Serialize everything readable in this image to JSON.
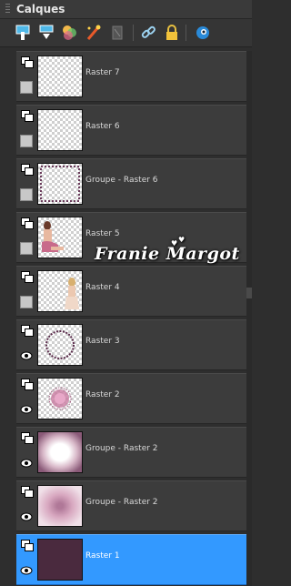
{
  "panel": {
    "title": "Calques"
  },
  "toolbar": {
    "buttons": [
      {
        "icon": "new-layer-icon"
      },
      {
        "icon": "new-mask-layer-icon"
      },
      {
        "icon": "adjustment-layer-icon"
      },
      {
        "icon": "layer-effects-icon"
      },
      {
        "icon": "delete-layer-icon"
      },
      {
        "icon": "link-icon"
      },
      {
        "icon": "lock-icon"
      },
      {
        "icon": "visibility-toggle-icon"
      }
    ]
  },
  "layers": [
    {
      "name": "Raster 7",
      "visible": false,
      "thumb": "empty",
      "selected": false
    },
    {
      "name": "Raster 6",
      "visible": false,
      "thumb": "empty",
      "selected": false
    },
    {
      "name": "Groupe - Raster 6",
      "visible": false,
      "thumb": "frame",
      "selected": false
    },
    {
      "name": "Raster 5",
      "visible": false,
      "thumb": "woman-sitting",
      "selected": false
    },
    {
      "name": "Raster 4",
      "visible": false,
      "thumb": "woman-standing",
      "selected": false
    },
    {
      "name": "Raster 3",
      "visible": true,
      "thumb": "circle-ring",
      "selected": false
    },
    {
      "name": "Raster 2",
      "visible": true,
      "thumb": "lace-flower",
      "selected": false
    },
    {
      "name": "Groupe - Raster 2",
      "visible": true,
      "thumb": "mauve-vignette",
      "selected": false
    },
    {
      "name": "Groupe - Raster 2",
      "visible": true,
      "thumb": "mauve-oval",
      "selected": false
    },
    {
      "name": "Raster 1",
      "visible": true,
      "thumb": "solid-plum",
      "selected": true
    }
  ],
  "watermark": {
    "text": "Franie Margot"
  },
  "colors": {
    "selected": "#3399ff",
    "plum": "#4a2a3e",
    "mauve": "#8a5a78"
  }
}
